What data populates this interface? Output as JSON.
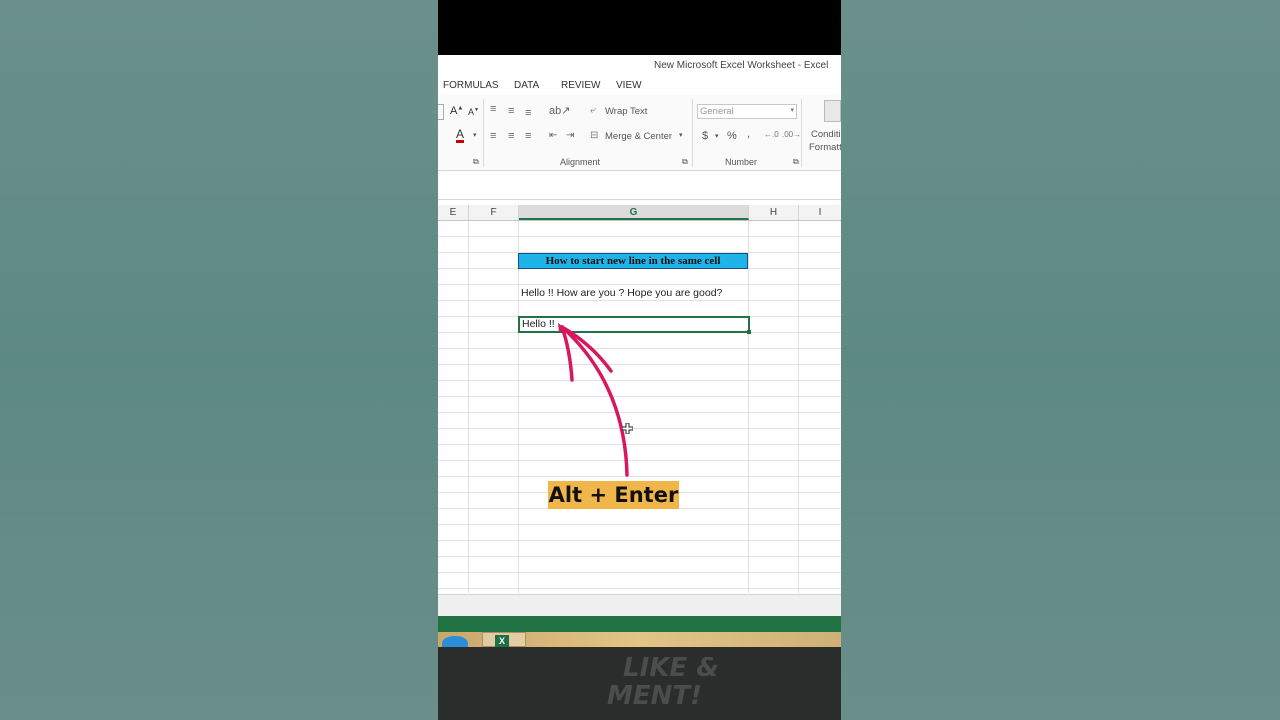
{
  "window": {
    "title": "New Microsoft Excel Worksheet - Excel"
  },
  "tabs": [
    "FORMULAS",
    "DATA",
    "REVIEW",
    "VIEW"
  ],
  "ribbon": {
    "wrap_text": "Wrap Text",
    "merge_center": "Merge & Center",
    "number_format": "General",
    "alignment_label": "Alignment",
    "number_label": "Number",
    "conditional_line1": "Conditi",
    "conditional_line2": "Formatt",
    "currency": "$",
    "percent": "%",
    "comma": ","
  },
  "columns": [
    "E",
    "F",
    "G",
    "H",
    "I"
  ],
  "selected_column": "G",
  "cells": {
    "title_cell": "How to start new line in the same cell",
    "text_cell": "Hello !! How are you ? Hope you are good?",
    "active_cell": "Hello !!"
  },
  "overlay": {
    "label": "Alt + Enter",
    "like_line1": "LIKE &",
    "like_line2": "MENT!"
  },
  "colors": {
    "excel_green": "#217346",
    "title_fill": "#1fb4e8",
    "label_fill": "#f1b64a",
    "arrow": "#d8175e"
  }
}
